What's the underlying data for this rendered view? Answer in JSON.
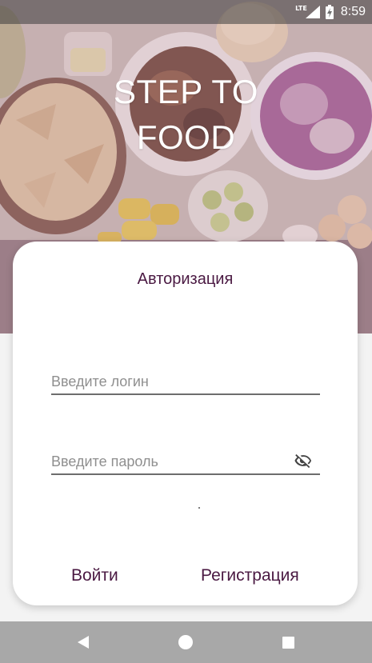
{
  "status_bar": {
    "network": "LTE",
    "time": "8:59"
  },
  "header": {
    "title_line1": "STEP TO",
    "title_line2": "FOOD"
  },
  "auth": {
    "title": "Авторизация",
    "login_placeholder": "Введите логин",
    "login_value": "",
    "password_placeholder": "Введите пароль",
    "password_value": "",
    "login_button": "Войти",
    "register_button": "Регистрация"
  },
  "icons": {
    "password_toggle": "eye-off-icon",
    "nav_back": "back-triangle-icon",
    "nav_home": "home-circle-icon",
    "nav_recents": "recents-square-icon"
  },
  "colors": {
    "accent": "#4a1942",
    "field_line": "#6d6d6d",
    "nav_bar": "#a8a8a8"
  }
}
